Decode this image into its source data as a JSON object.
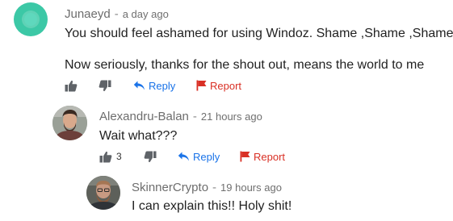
{
  "comments": [
    {
      "author": "Junaeyd",
      "separator": "-",
      "time": "a day ago",
      "lines": [
        "You should feel ashamed for using Windoz. Shame ,Shame ,Shame",
        "Now seriously, thanks for the shout out, means the world to me"
      ],
      "like_count": "",
      "reply_label": "Reply",
      "report_label": "Report"
    },
    {
      "author": "Alexandru-Balan",
      "separator": "-",
      "time": "21 hours ago",
      "lines": [
        "Wait what???"
      ],
      "like_count": "3",
      "reply_label": "Reply",
      "report_label": "Report"
    },
    {
      "author": "SkinnerCrypto",
      "separator": "-",
      "time": "19 hours ago",
      "lines": [
        "I can explain this!! Holy shit!"
      ]
    }
  ],
  "colors": {
    "link": "#1a73e8",
    "report": "#d93025",
    "meta": "#707070",
    "avatar_1": "#3cc8a6"
  }
}
